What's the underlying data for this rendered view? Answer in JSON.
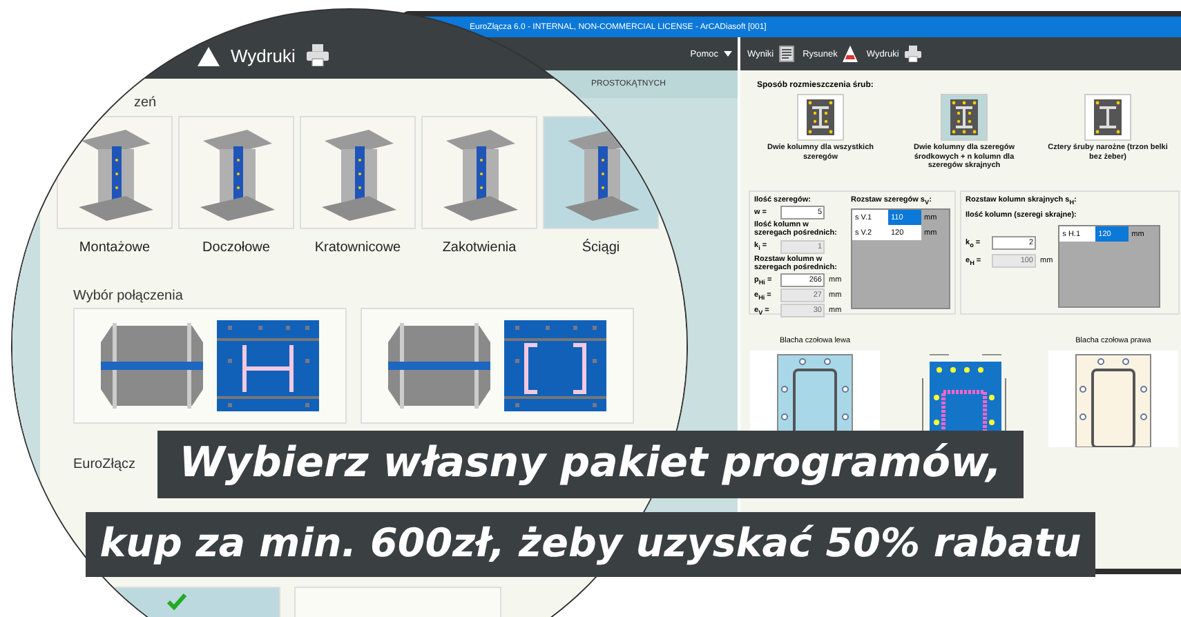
{
  "app_window": {
    "title": "EuroZłącza 6.0 - INTERNAL, NON-COMMERCIAL LICENSE - ArCADiasoft [001]",
    "menu": [
      {
        "label": "Pomoc"
      }
    ],
    "tab_label": "PROSTOKĄTNYCH",
    "toolbar": [
      {
        "label": "Wyniki",
        "kind": "results"
      },
      {
        "label": "Rysunek",
        "kind": "drawing"
      },
      {
        "label": "Wydruki",
        "kind": "print"
      }
    ],
    "bolt_layout": {
      "label": "Sposób rozmieszczenia śrub:",
      "options": [
        {
          "label": "Dwie kolumny dla wszystkich szeregów",
          "selected": false,
          "kind": "two"
        },
        {
          "label": "Dwie kolumny dla szeregów środkowych + n kolumn dla szeregów skrajnych",
          "selected": true,
          "kind": "multi"
        },
        {
          "label": "Cztery śruby narożne (trzon belki bez żeber)",
          "selected": false,
          "kind": "corner"
        }
      ]
    },
    "rows_panel": {
      "heading": "Ilość szeregów:",
      "fields": [
        {
          "kind": "field",
          "label": "w =",
          "value": "5",
          "disabled": false
        },
        {
          "kind": "heading",
          "label": "Ilość kolumn w szeregach pośrednich:"
        },
        {
          "kind": "field",
          "label": "k$_{i}$ =",
          "value": "1",
          "disabled": true
        },
        {
          "kind": "heading",
          "label": "Rozstaw kolumn w szeregach pośrednich:"
        },
        {
          "kind": "field",
          "label": "p$_{Hi}$ =",
          "value": "266",
          "unit": "mm",
          "disabled": false
        },
        {
          "kind": "field",
          "label": "e$_{Hi}$ =",
          "value": "27",
          "unit": "mm",
          "disabled": true
        },
        {
          "kind": "field",
          "label": "e$_{V}$ =",
          "value": "30",
          "unit": "mm",
          "disabled": true
        }
      ],
      "table_label": "Rozstaw szeregów s$_{V}$:",
      "table": [
        {
          "label": "s V.1",
          "value": "110",
          "unit": "mm",
          "selected": true
        },
        {
          "label": "s V.2",
          "value": "120",
          "unit": "mm",
          "selected": false
        }
      ]
    },
    "edge_panel": {
      "heading": "Rozstaw kolumn skrajnych s$_{H}$:",
      "subheading": "Ilość kolumn (szeregi skrajne):",
      "fields": [
        {
          "label": "k$_{o}$ =",
          "value": "2",
          "disabled": false
        },
        {
          "label": "e$_{H}$ =",
          "value": "100",
          "unit": "mm",
          "disabled": true
        }
      ],
      "table": [
        {
          "label": "s H.1",
          "value": "120",
          "unit": "mm",
          "selected": true
        }
      ]
    },
    "plates": [
      {
        "label": "Blacha czołowa lewa",
        "kind": "left"
      },
      {
        "kind": "dimensioned"
      },
      {
        "label": "Blacha czołowa prawa",
        "kind": "right"
      }
    ]
  },
  "magnifier": {
    "toolbar_label": "Wydruki",
    "section_label": "zeń",
    "tiles": [
      {
        "label": "Montażowe",
        "selected": false
      },
      {
        "label": "Doczołowe",
        "selected": false
      },
      {
        "label": "Kratownicowe",
        "selected": false
      },
      {
        "label": "Zakotwienia",
        "selected": false
      },
      {
        "label": "Ściągi",
        "selected": true
      }
    ],
    "choice_label": "Wybór połączenia",
    "choices": [
      {
        "selected": false
      },
      {
        "selected": false
      }
    ],
    "group_label": "EuroZłącz",
    "lower_choices": [
      {
        "selected": true
      },
      {
        "selected": false
      }
    ]
  },
  "banners": [
    "Wybierz własny pakiet programów,",
    "kup za min. 600zł, żeby uzyskać 50% rabatu"
  ]
}
